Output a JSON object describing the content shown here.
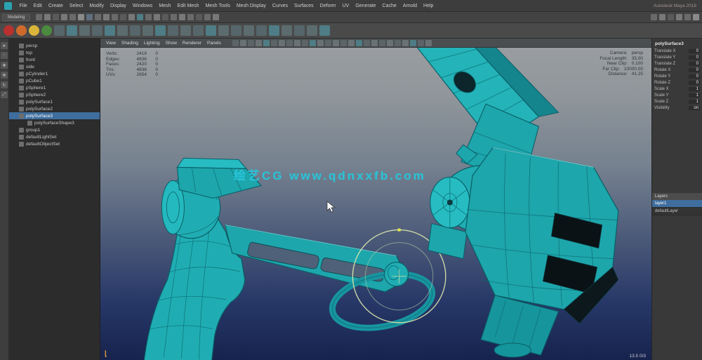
{
  "window": {
    "title": "Autodesk Maya 2018"
  },
  "menubar": {
    "items": [
      "File",
      "Edit",
      "Create",
      "Select",
      "Modify",
      "Display",
      "Windows",
      "Mesh",
      "Edit Mesh",
      "Mesh Tools",
      "Mesh Display",
      "Curves",
      "Surfaces",
      "Deform",
      "UV",
      "Generate",
      "Cache",
      "Arnold",
      "Help"
    ]
  },
  "statusline": {
    "menu_set": "Modeling",
    "icons": [
      "#6a6a6a",
      "#787878",
      "#5a5a5a",
      "#787878",
      "#6a6a6a",
      "#8a8a8a",
      "#5f6f7f",
      "#6a6a6a",
      "#787878",
      "#6a6a6a",
      "#5a5a5a",
      "#787878",
      "#4e7d85",
      "#6a6a6a",
      "#787878",
      "#5a5a5a",
      "#6a6a6a",
      "#787878",
      "#6a6a6a",
      "#5a5a5a",
      "#6a6a6a",
      "#787878"
    ],
    "right_icons": [
      "#6a6a6a",
      "#787878",
      "#5a5a5a",
      "#787878",
      "#6a6a6a",
      "#8a8a8a"
    ]
  },
  "shelf": {
    "icons": [
      {
        "c": "#b8312f",
        "cls": "round"
      },
      {
        "c": "#d06a2c",
        "cls": "round"
      },
      {
        "c": "#d9b63b",
        "cls": "round"
      },
      {
        "c": "#4c8a3f",
        "cls": "round"
      },
      {
        "c": "#56666a"
      },
      {
        "c": "#4e7d85"
      },
      {
        "c": "#5c6b6e"
      },
      {
        "c": "#56666a"
      },
      {
        "c": "#4e7d85"
      },
      {
        "c": "#5c6b6e"
      },
      {
        "c": "#56666a"
      },
      {
        "c": "#5c6b6e"
      },
      {
        "c": "#4e7d85"
      },
      {
        "c": "#56666a"
      },
      {
        "c": "#5c6b6e"
      },
      {
        "c": "#56666a"
      },
      {
        "c": "#4e7d85"
      },
      {
        "c": "#5c6b6e"
      },
      {
        "c": "#56666a"
      },
      {
        "c": "#5c6b6e"
      },
      {
        "c": "#56666a"
      },
      {
        "c": "#4e7d85"
      },
      {
        "c": "#5c6b6e"
      },
      {
        "c": "#56666a"
      },
      {
        "c": "#5c6b6e"
      },
      {
        "c": "#4e7d85"
      }
    ]
  },
  "toolbox": {
    "items": [
      {
        "glyph": "➤"
      },
      {
        "glyph": "◌"
      },
      {
        "glyph": "✚"
      },
      {
        "glyph": "✥"
      },
      {
        "glyph": "↻"
      },
      {
        "glyph": "⤢"
      }
    ]
  },
  "outliner": {
    "items": [
      {
        "label": "persp",
        "cls": ""
      },
      {
        "label": "top",
        "cls": ""
      },
      {
        "label": "front",
        "cls": ""
      },
      {
        "label": "side",
        "cls": ""
      },
      {
        "label": "pCylinder1",
        "cls": ""
      },
      {
        "label": "pCube1",
        "cls": ""
      },
      {
        "label": "pSphere1",
        "cls": ""
      },
      {
        "label": "pSphere2",
        "cls": ""
      },
      {
        "label": "polySurface1",
        "cls": ""
      },
      {
        "label": "polySurface2",
        "cls": ""
      },
      {
        "label": "polySurface3",
        "cls": "selected"
      },
      {
        "label": "polySurfaceShape3",
        "cls": "indent"
      },
      {
        "label": "group1",
        "cls": ""
      },
      {
        "label": "defaultLightSet",
        "cls": ""
      },
      {
        "label": "defaultObjectSet",
        "cls": ""
      }
    ]
  },
  "panelmenu": {
    "items": [
      "View",
      "Shading",
      "Lighting",
      "Show",
      "Renderer",
      "Panels"
    ],
    "icons": [
      "#5d6467",
      "#6a7174",
      "#5d6467",
      "#6a7174",
      "#4e7d85",
      "#5d6467",
      "#6a7174",
      "#5d6467",
      "#6a7174",
      "#5d6467",
      "#4e7d85",
      "#6a7174",
      "#5d6467",
      "#6a7174",
      "#5d6467",
      "#6a7174",
      "#4e7d85",
      "#5d6467",
      "#6a7174",
      "#5d6467",
      "#6a7174",
      "#5d6467",
      "#6a7174",
      "#4e7d85",
      "#5d6467",
      "#6a7174"
    ]
  },
  "viewport": {
    "watermark": "绘艺CG www.qdnxxfb.com",
    "bottom_right": "13.5 0/3",
    "hud_left": [
      {
        "label": "Verts:",
        "a": "2418",
        "b": "0"
      },
      {
        "label": "Edges:",
        "a": "4836",
        "b": "0"
      },
      {
        "label": "Faces:",
        "a": "2420",
        "b": "0"
      },
      {
        "label": "Tris:",
        "a": "4836",
        "b": "0"
      },
      {
        "label": "UVs:",
        "a": "2654",
        "b": "0"
      }
    ],
    "hud_right": [
      {
        "label": "Camera:",
        "value": "persp"
      },
      {
        "label": "Focal Length:",
        "value": "35.00"
      },
      {
        "label": "Near Clip:",
        "value": "0.100"
      },
      {
        "label": "Far Clip:",
        "value": "10000.00"
      },
      {
        "label": "Distance:",
        "value": "41.25"
      }
    ]
  },
  "channel_box": {
    "object": "polySurface3",
    "rows": [
      {
        "label": "Translate X",
        "value": "0"
      },
      {
        "label": "Translate Y",
        "value": "0"
      },
      {
        "label": "Translate Z",
        "value": "0"
      },
      {
        "label": "Rotate X",
        "value": "0"
      },
      {
        "label": "Rotate Y",
        "value": "0"
      },
      {
        "label": "Rotate Z",
        "value": "0"
      },
      {
        "label": "Scale X",
        "value": "1"
      },
      {
        "label": "Scale Y",
        "value": "1"
      },
      {
        "label": "Scale Z",
        "value": "1"
      },
      {
        "label": "Visibility",
        "value": "on"
      }
    ]
  },
  "layers_panel": {
    "header": "Layers",
    "rows": [
      {
        "label": "layer1",
        "cls": "selected"
      },
      {
        "label": "defaultLayer",
        "cls": ""
      }
    ]
  },
  "colors": {
    "model_fill": "#1fadb3",
    "model_wire": "#0b5e66",
    "model_dark": "#0a1216",
    "manipulator": "#d9e6ae",
    "watermark": "#29c5da",
    "selection_highlight": "#3f6e9e"
  }
}
